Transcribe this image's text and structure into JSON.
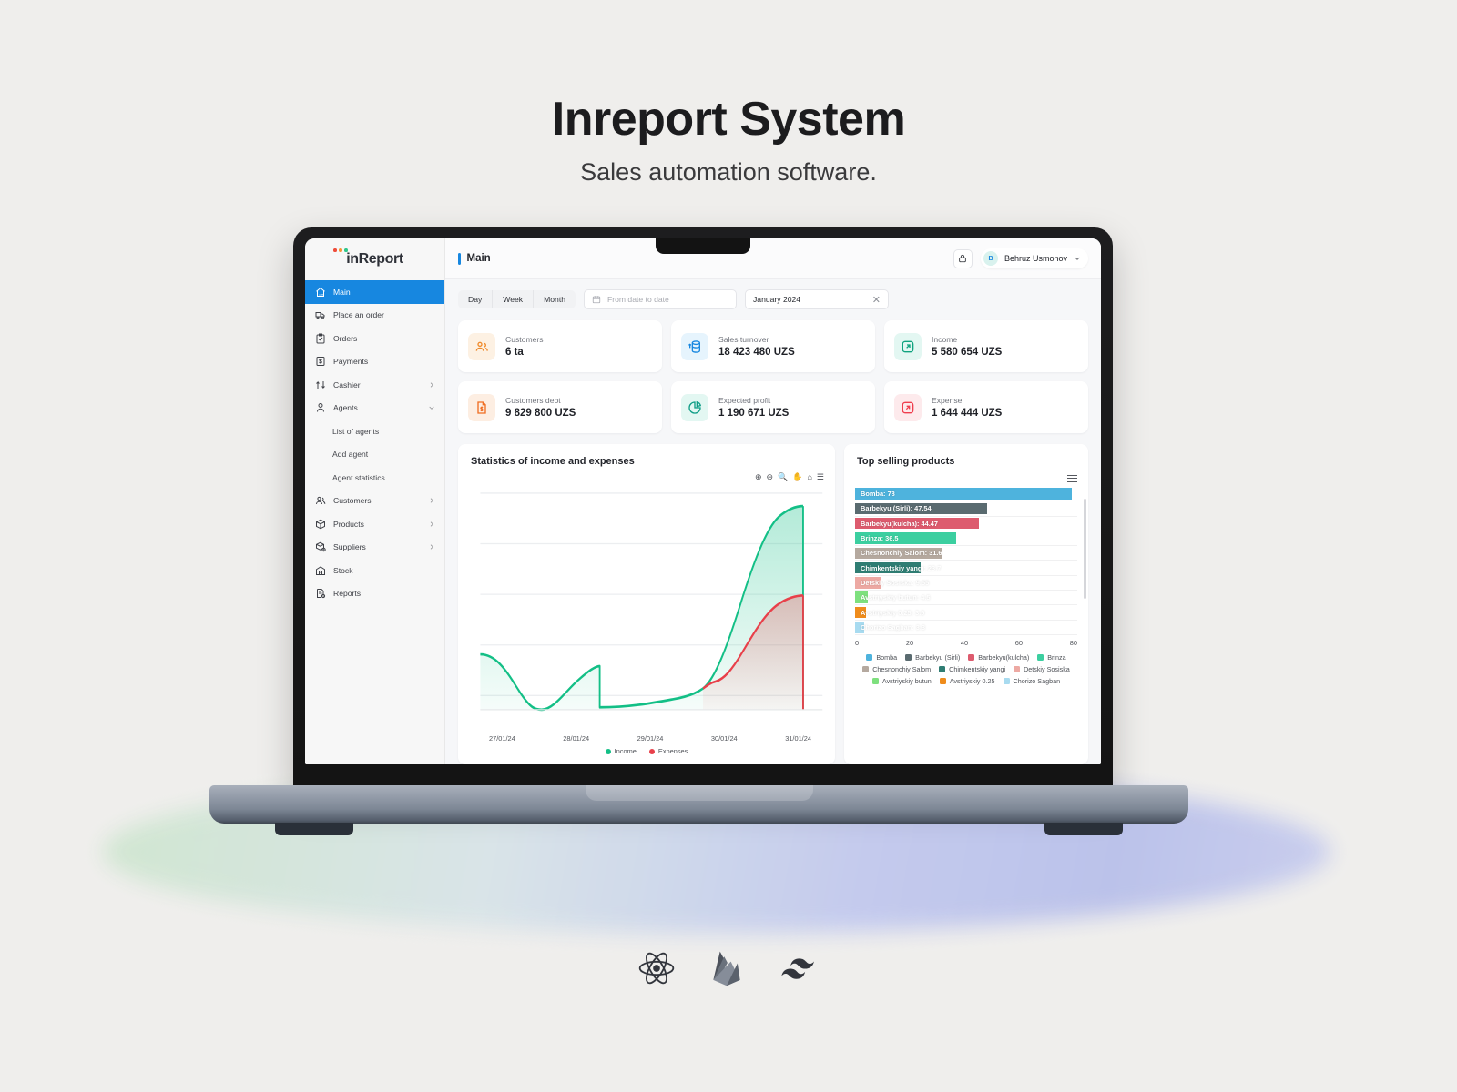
{
  "hero": {
    "title": "Inreport System",
    "subtitle": "Sales automation software."
  },
  "brand": {
    "name": "inReport",
    "dots": [
      "#ef4c3a",
      "#f79535",
      "#2fc78a"
    ]
  },
  "header": {
    "page_title": "Main",
    "lock_icon": "lock-icon",
    "user": {
      "initial": "B",
      "name": "Behruz Usmonov",
      "chevron": "chevron-down-icon"
    }
  },
  "sidebar": {
    "items": [
      {
        "label": "Main",
        "icon": "home-icon",
        "active": true,
        "chevron": ""
      },
      {
        "label": "Place an order",
        "icon": "truck-icon",
        "active": false,
        "chevron": ""
      },
      {
        "label": "Orders",
        "icon": "clipboard-icon",
        "active": false,
        "chevron": ""
      },
      {
        "label": "Payments",
        "icon": "money-icon",
        "active": false,
        "chevron": ""
      },
      {
        "label": "Cashier",
        "icon": "cashier-icon",
        "active": false,
        "chevron": "chevron-right-icon"
      },
      {
        "label": "Agents",
        "icon": "person-icon",
        "active": false,
        "chevron": "chevron-down-icon"
      }
    ],
    "sub_items": [
      "List of agents",
      "Add agent",
      "Agent statistics"
    ],
    "items_after": [
      {
        "label": "Customers",
        "icon": "people-icon",
        "chevron": "chevron-right-icon"
      },
      {
        "label": "Products",
        "icon": "box-icon",
        "chevron": "chevron-right-icon"
      },
      {
        "label": "Suppliers",
        "icon": "supplier-icon",
        "chevron": "chevron-right-icon"
      },
      {
        "label": "Stock",
        "icon": "warehouse-icon",
        "chevron": ""
      },
      {
        "label": "Reports",
        "icon": "report-icon",
        "chevron": ""
      }
    ]
  },
  "filters": {
    "segments": [
      "Day",
      "Week",
      "Month"
    ],
    "date_range": {
      "placeholder": "From date to date",
      "value": "",
      "icon": "calendar-icon"
    },
    "month": {
      "value": "January 2024",
      "clear_icon": "close-icon"
    }
  },
  "stats": [
    {
      "label": "Customers",
      "value": "6 ta",
      "icon": "customers-icon",
      "bg": "#fdf1e3",
      "fg": "#f08a2a"
    },
    {
      "label": "Sales turnover",
      "value": "18 423 480 UZS",
      "icon": "turnover-icon",
      "bg": "#e6f4fd",
      "fg": "#1787e0"
    },
    {
      "label": "Income",
      "value": "5 580 654 UZS",
      "icon": "income-icon",
      "bg": "#e3f7f2",
      "fg": "#10a37f"
    },
    {
      "label": "Customers debt",
      "value": "9 829 800 UZS",
      "icon": "debt-icon",
      "bg": "#fdeee2",
      "fg": "#f06e22"
    },
    {
      "label": "Expected profit",
      "value": "1 190 671 UZS",
      "icon": "pie-icon",
      "bg": "#e3f7f2",
      "fg": "#0f9d86"
    },
    {
      "label": "Expense",
      "value": "1 644 444 UZS",
      "icon": "expense-icon",
      "bg": "#fdeaec",
      "fg": "#ef3e4e"
    }
  ],
  "line_panel": {
    "title": "Statistics of income and expenses",
    "tools": [
      "zoom-in-icon",
      "zoom-out-icon",
      "selection-zoom-icon",
      "pan-icon",
      "reset-icon",
      "menu-icon"
    ]
  },
  "bar_panel": {
    "title": "Top selling products",
    "menu_icon": "menu-icon"
  },
  "chart_data": [
    {
      "type": "area",
      "title": "Statistics of income and expenses",
      "xlabel": "",
      "ylabel": "",
      "grid": true,
      "legend_position": "bottom",
      "x": [
        "27/01/24",
        "28/01/24",
        "29/01/24",
        "30/01/24",
        "31/01/24"
      ],
      "xticks": [
        "27/01/24",
        "28/01/24",
        "29/01/24",
        "30/01/24",
        "31/01/24"
      ],
      "series": [
        {
          "name": "Income",
          "color": "#13bf86",
          "values": [
            32,
            3,
            22,
            2,
            8,
            97
          ]
        },
        {
          "name": "Expenses",
          "color": "#e8404a",
          "values": [
            0,
            0,
            0,
            0,
            10,
            55
          ]
        }
      ]
    },
    {
      "type": "bar",
      "orientation": "horizontal",
      "title": "Top selling products",
      "xlim": [
        0,
        80
      ],
      "xticks": [
        0,
        20,
        40,
        60,
        80
      ],
      "grid": true,
      "legend_position": "bottom",
      "categories": [
        "Bomba",
        "Barbekyu (Sirli)",
        "Barbekyu(kulcha)",
        "Brinza",
        "Chesnonchiy Salom",
        "Chimkentskiy yangi",
        "Detskiy Sosiska",
        "Avstriyskiy butun",
        "Avstriyskiy 0.25",
        "Chorizo Sagban"
      ],
      "values": [
        78,
        47.54,
        44.47,
        36.5,
        31.6,
        23.7,
        9.55,
        4.5,
        3.9,
        3.3
      ],
      "labels": [
        "Bomba: 78",
        "Barbekyu (Sirli): 47.54",
        "Barbekyu(kulcha): 44.47",
        "Brinza: 36.5",
        "Chesnonchiy Salom: 31.6",
        "Chimkentskiy yangi: 23.7",
        "Detskiy Sosiska: 9.55",
        "Avstriyskiy butun: 4.5",
        "Avstriyskiy 0.25: 3.9",
        "Chorizo Sagban: 3.3"
      ],
      "colors": [
        "#4eb3dd",
        "#5a6b70",
        "#dd5b6e",
        "#3ccfa0",
        "#b5a99f",
        "#2f7d73",
        "#eda9a3",
        "#7ee07e",
        "#ef8c1c",
        "#a8dbf0"
      ]
    }
  ],
  "tech_logos": [
    "react-icon",
    "firebase-icon",
    "tailwind-icon"
  ]
}
